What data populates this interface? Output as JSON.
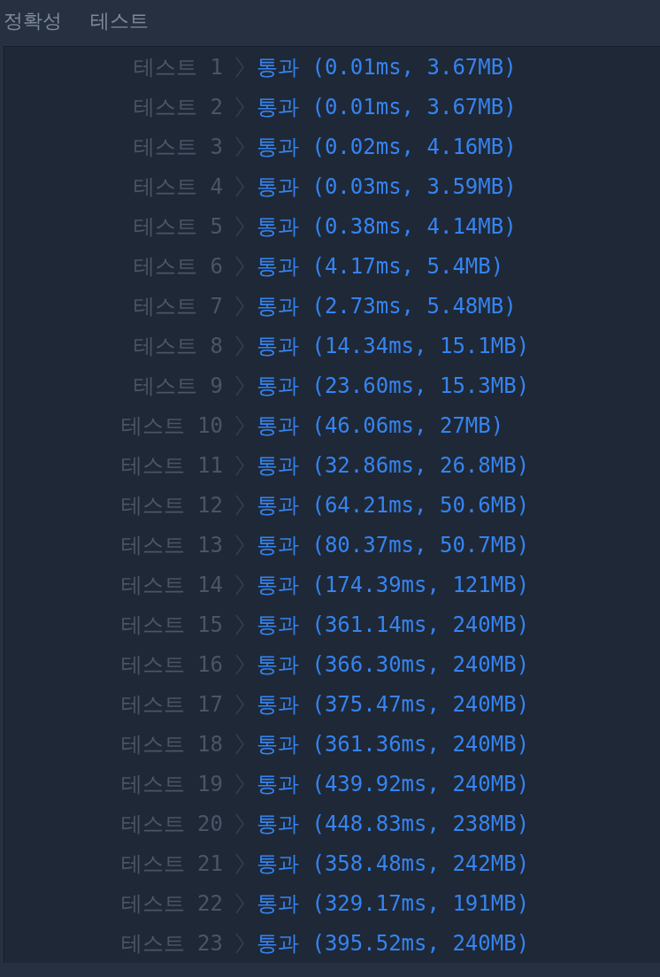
{
  "tabs": [
    {
      "label": "정확성"
    },
    {
      "label": "테스트"
    }
  ],
  "results": [
    {
      "label": "테스트 1",
      "result": "통과 (0.01ms, 3.67MB)"
    },
    {
      "label": "테스트 2",
      "result": "통과 (0.01ms, 3.67MB)"
    },
    {
      "label": "테스트 3",
      "result": "통과 (0.02ms, 4.16MB)"
    },
    {
      "label": "테스트 4",
      "result": "통과 (0.03ms, 3.59MB)"
    },
    {
      "label": "테스트 5",
      "result": "통과 (0.38ms, 4.14MB)"
    },
    {
      "label": "테스트 6",
      "result": "통과 (4.17ms, 5.4MB)"
    },
    {
      "label": "테스트 7",
      "result": "통과 (2.73ms, 5.48MB)"
    },
    {
      "label": "테스트 8",
      "result": "통과 (14.34ms, 15.1MB)"
    },
    {
      "label": "테스트 9",
      "result": "통과 (23.60ms, 15.3MB)"
    },
    {
      "label": "테스트 10",
      "result": "통과 (46.06ms, 27MB)"
    },
    {
      "label": "테스트 11",
      "result": "통과 (32.86ms, 26.8MB)"
    },
    {
      "label": "테스트 12",
      "result": "통과 (64.21ms, 50.6MB)"
    },
    {
      "label": "테스트 13",
      "result": "통과 (80.37ms, 50.7MB)"
    },
    {
      "label": "테스트 14",
      "result": "통과 (174.39ms, 121MB)"
    },
    {
      "label": "테스트 15",
      "result": "통과 (361.14ms, 240MB)"
    },
    {
      "label": "테스트 16",
      "result": "통과 (366.30ms, 240MB)"
    },
    {
      "label": "테스트 17",
      "result": "통과 (375.47ms, 240MB)"
    },
    {
      "label": "테스트 18",
      "result": "통과 (361.36ms, 240MB)"
    },
    {
      "label": "테스트 19",
      "result": "통과 (439.92ms, 240MB)"
    },
    {
      "label": "테스트 20",
      "result": "통과 (448.83ms, 238MB)"
    },
    {
      "label": "테스트 21",
      "result": "통과 (358.48ms, 242MB)"
    },
    {
      "label": "테스트 22",
      "result": "통과 (329.17ms, 191MB)"
    },
    {
      "label": "테스트 23",
      "result": "통과 (395.52ms, 240MB)"
    }
  ]
}
